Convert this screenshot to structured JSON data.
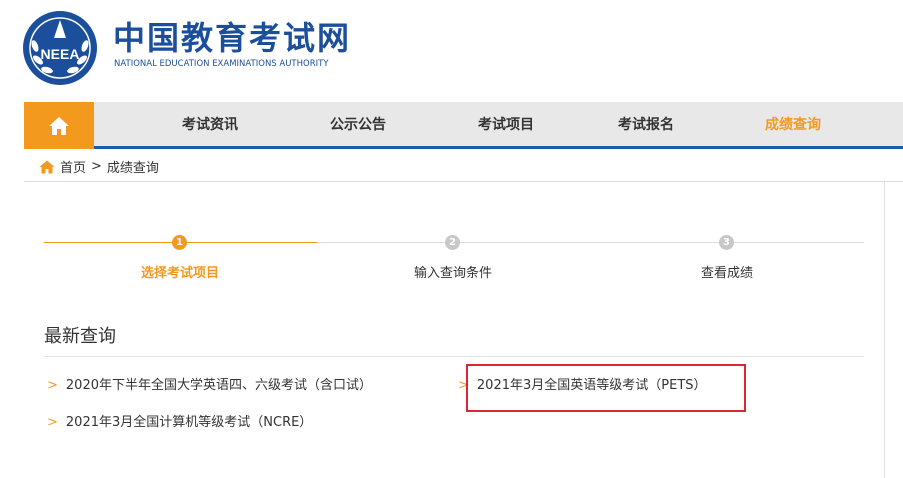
{
  "header": {
    "logo_cn": "中国教育考试网",
    "logo_en": "NATIONAL EDUCATION EXAMINATIONS AUTHORITY",
    "emblem_text": "NEEA"
  },
  "nav": {
    "home_icon": "home-icon",
    "items": [
      {
        "label": "考试资讯",
        "active": false
      },
      {
        "label": "公示公告",
        "active": false
      },
      {
        "label": "考试项目",
        "active": false
      },
      {
        "label": "考试报名",
        "active": false
      },
      {
        "label": "成绩查询",
        "active": true
      }
    ]
  },
  "breadcrumb": {
    "home": "首页",
    "separator": ">",
    "current": "成绩查询"
  },
  "steps": [
    {
      "number": "1",
      "label": "选择考试项目",
      "active": true
    },
    {
      "number": "2",
      "label": "输入查询条件",
      "active": false
    },
    {
      "number": "3",
      "label": "查看成绩",
      "active": false
    }
  ],
  "recent": {
    "title": "最新查询",
    "chevron": ">",
    "links": [
      "2020年下半年全国大学英语四、六级考试（含口试）",
      "2021年3月全国英语等级考试（PETS）",
      "2021年3月全国计算机等级考试（NCRE）"
    ]
  },
  "colors": {
    "brand_blue": "#1b4f9c",
    "accent_orange": "#f39a1e",
    "highlight_red": "#d9282f"
  }
}
